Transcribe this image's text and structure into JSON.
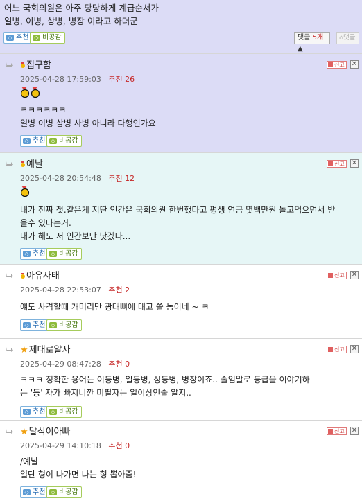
{
  "post_tail": {
    "lines": [
      "어느 국회의원은 아주 당당하게  계급순서가",
      "일병, 이병, 상병, 병장 이라고 하더군"
    ],
    "recommend_label": "추천",
    "not_recommend_label": "비공감",
    "comment_count_label": "댓글",
    "comment_count": "5개",
    "comment_count_arrow": "▲",
    "reply_label": "댓글"
  },
  "labels": {
    "recommend_prefix": "추천",
    "report": "신고",
    "delete": "✕",
    "rec_button": "추천",
    "nrec_button": "비공감"
  },
  "comments": [
    {
      "nick": "집구함",
      "badge": "medal",
      "date": "2025-04-28 17:59:03",
      "recommend": "26",
      "medals": 2,
      "lines": [
        "ㅋㅋㅋㅋㅋㅋ",
        "일병 이병 삼병 사병 아니라 다행인가요"
      ]
    },
    {
      "nick": "예날",
      "badge": "medal",
      "date": "2025-04-28 20:54:48",
      "recommend": "12",
      "medals": 1,
      "lines": [
        "내가 진짜 젓.같은게 저딴 인간은 국회의원 한번했다고 평생 연금 몇백만원 놀고먹으면서 받",
        "을수 있다는거.",
        "내가 해도 저 인간보단 낫겠다..."
      ]
    },
    {
      "nick": "아유사태",
      "badge": "medal",
      "date": "2025-04-28 22:53:07",
      "recommend": "2",
      "medals": 0,
      "lines": [
        "얘도 사격할때 개머리만 광대뼈에 대고 쏠 놈이네 ~ ㅋ"
      ]
    },
    {
      "nick": "제대로알자",
      "badge": "star",
      "date": "2025-04-29 08:47:28",
      "recommend": "0",
      "medals": 0,
      "lines": [
        "ㅋㅋㅋ 정확한 용어는 이등병, 일등병, 상등병, 병장이죠.. 줄임말로 등급을 이야기하",
        "는 '등' 자가 빠지니깐 미필자는 일이상인줄 알지.."
      ]
    },
    {
      "nick": "달식이아빠",
      "badge": "star",
      "date": "2025-04-29 14:10:18",
      "recommend": "0",
      "medals": 0,
      "lines": [
        "/예날",
        "일단 형이 나가면 나는 형 뽑아줌!"
      ]
    }
  ],
  "colors": {
    "highlight_top": "#dcdcf6",
    "highlight_purple": "#dcdcf6",
    "highlight_teal": "#e6f6f6",
    "recommend_count": "#c62828"
  }
}
